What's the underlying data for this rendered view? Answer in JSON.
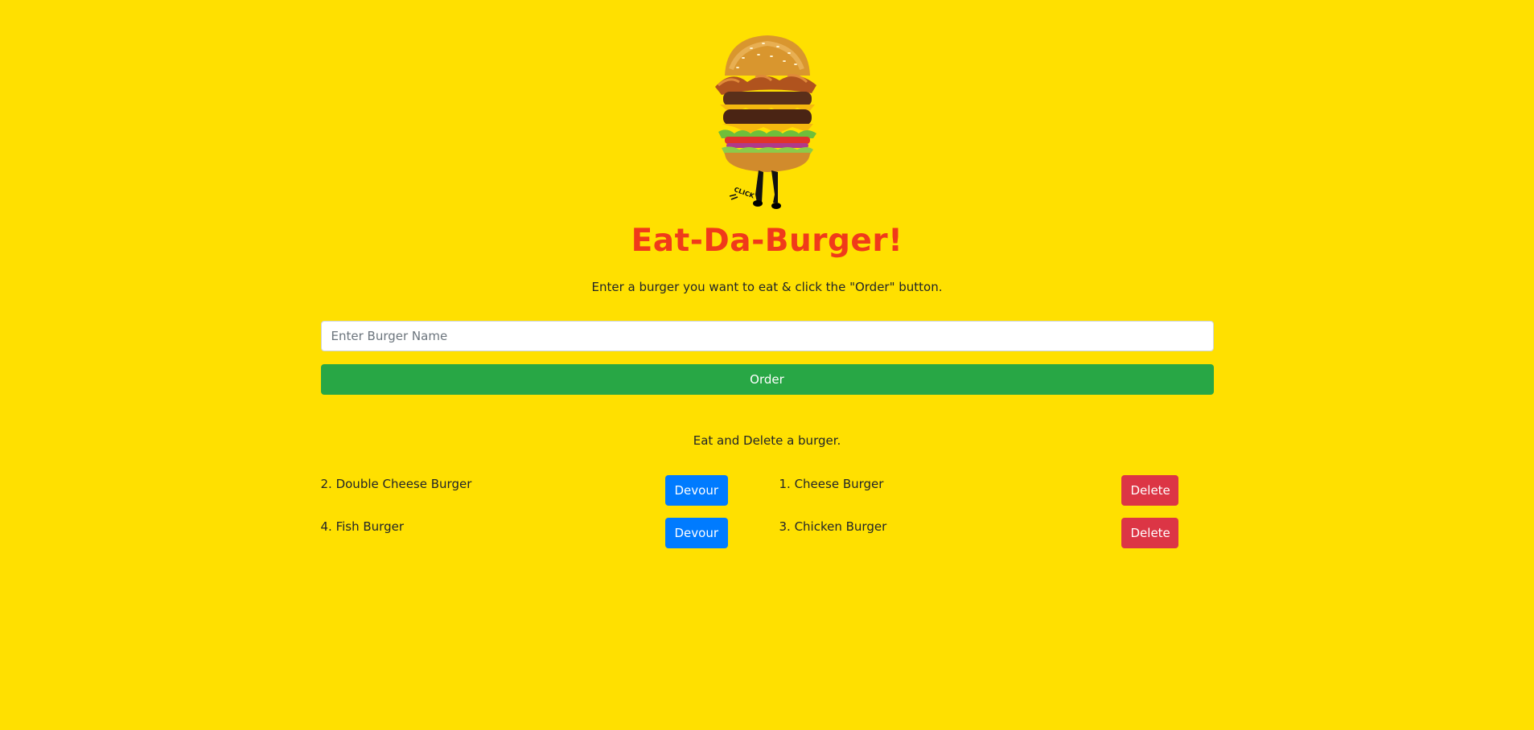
{
  "header": {
    "title": "Eat-Da-Burger!",
    "intro": "Enter a burger you want to eat & click the \"Order\" button.",
    "logo_icon": "walking-burger-icon",
    "logo_caption": "CLICK"
  },
  "order_form": {
    "placeholder": "Enter Burger Name",
    "value": "",
    "order_label": "Order"
  },
  "lists": {
    "heading": "Eat and Delete a burger.",
    "to_devour": [
      {
        "label": "2. Double Cheese Burger",
        "action": "Devour"
      },
      {
        "label": "4. Fish Burger",
        "action": "Devour"
      }
    ],
    "devoured": [
      {
        "label": "1. Cheese Burger",
        "action": "Delete"
      },
      {
        "label": "3. Chicken Burger",
        "action": "Delete"
      }
    ]
  },
  "colors": {
    "background": "#FFE000",
    "title": "#F03A1A",
    "order_button": "#28A745",
    "devour_button": "#007BFF",
    "delete_button": "#DC3545"
  }
}
